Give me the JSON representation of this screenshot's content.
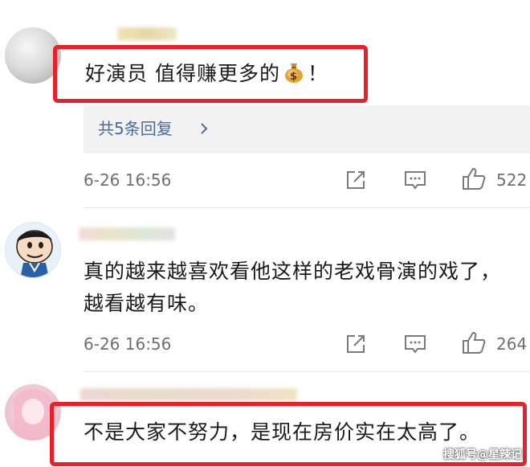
{
  "comments": [
    {
      "text_before_icon": "好演员 值得赚更多的",
      "icon": "money-bag-icon",
      "text_after_icon": "！",
      "replies_label": "共5条回复",
      "time": "6-26 16:56",
      "likes": "522"
    },
    {
      "text": "真的越来越喜欢看他这样的老戏骨演的戏了，越看越有味。",
      "time": "6-26 16:56",
      "likes": "264"
    },
    {
      "text": "不是大家不努力，是现在房价实在太高了。"
    }
  ],
  "watermark": "搜狐号@星辣记",
  "colors": {
    "highlight": "#e8202a",
    "reply_link": "#4a6a9a",
    "meta": "#6f6f6f"
  }
}
